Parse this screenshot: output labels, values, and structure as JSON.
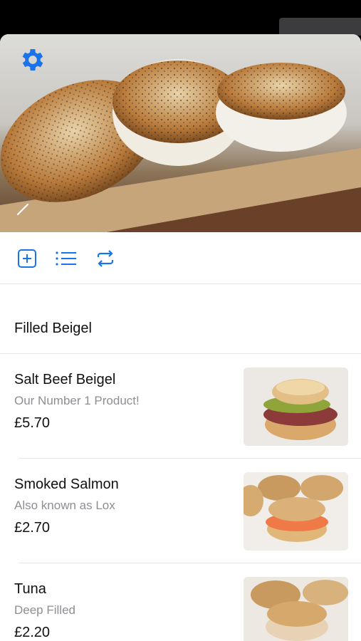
{
  "section": {
    "title": "Filled Beigel"
  },
  "items": [
    {
      "name": "Salt Beef Beigel",
      "description": "Our Number 1 Product!",
      "price": "£5.70",
      "image": "salt-beef-beigel-photo"
    },
    {
      "name": "Smoked Salmon",
      "description": "Also known as Lox",
      "price": "£2.70",
      "image": "smoked-salmon-beigel-photo"
    },
    {
      "name": "Tuna",
      "description": "Deep Filled",
      "price": "£2.20",
      "image": "tuna-beigel-photo"
    }
  ],
  "toolbar": {
    "icons": [
      "add-icon",
      "list-icon",
      "repeat-icon"
    ]
  },
  "hero": {
    "image": "poppy-seed-beigels-photo",
    "icons": [
      "gear-icon",
      "pencil-icon"
    ]
  },
  "colors": {
    "accent": "#1a73e8",
    "text": "#111111",
    "secondary": "#8e8e93",
    "divider": "#e6e6e6"
  }
}
